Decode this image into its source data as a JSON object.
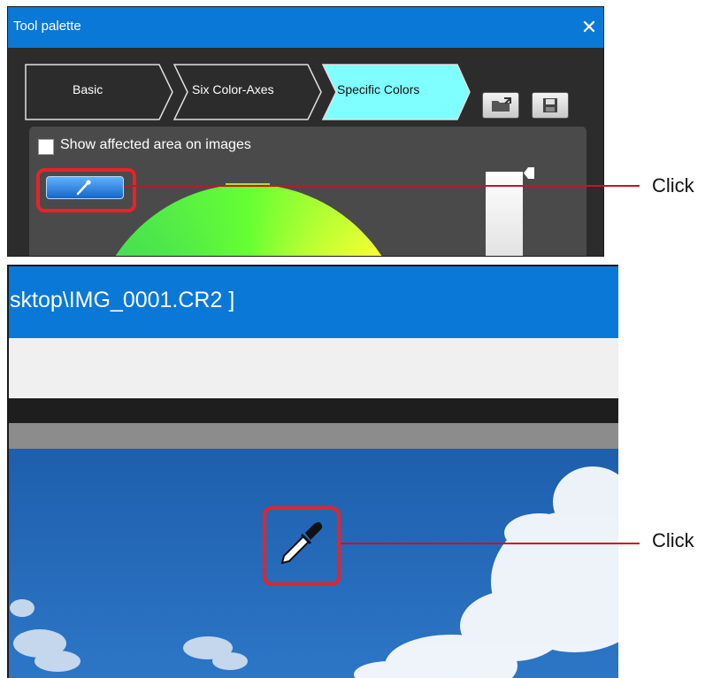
{
  "tool_palette": {
    "title": "Tool palette",
    "close_glyph": "✕",
    "tabs": [
      {
        "label": "Basic",
        "active": false
      },
      {
        "label": "Six Color-Axes",
        "active": false
      },
      {
        "label": "Specific Colors",
        "active": true
      }
    ],
    "checkbox_label": "Show affected area on images",
    "icons": [
      "open-folder-icon",
      "save-icon",
      "eyedropper-icon",
      "close-icon"
    ]
  },
  "viewer": {
    "title_fragment": "sktop\\IMG_0001.CR2 ]",
    "cursor_icon": "eyedropper-cursor-icon"
  },
  "callouts": {
    "first": "Click",
    "second": "Click"
  },
  "colors": {
    "titlebar_blue": "#0a78d7",
    "active_tab": "#7fffff",
    "highlight_red": "#e8222a",
    "sky_blue": "#2468b8"
  }
}
